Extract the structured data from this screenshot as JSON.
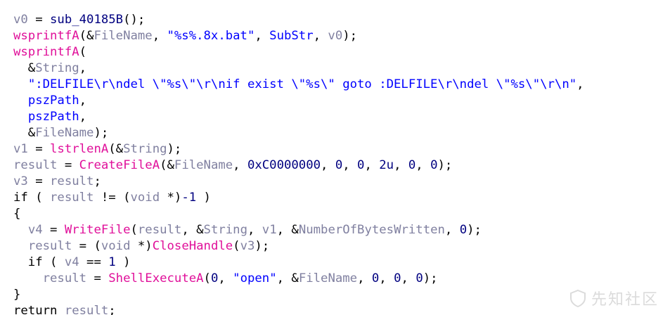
{
  "colors": {
    "plain": "#000000",
    "variable": "#8080a0",
    "function": "#e0109a",
    "string": "#0000ff",
    "number": "#000080",
    "global": "#0000ff"
  },
  "code_lines": [
    [
      {
        "t": "v0",
        "c": "variable"
      },
      {
        "t": " = ",
        "c": "plain"
      },
      {
        "t": "sub_40185B",
        "c": "number"
      },
      {
        "t": "();",
        "c": "plain"
      }
    ],
    [
      {
        "t": "wsprintfA",
        "c": "function"
      },
      {
        "t": "(&",
        "c": "plain"
      },
      {
        "t": "FileName",
        "c": "variable"
      },
      {
        "t": ", ",
        "c": "plain"
      },
      {
        "t": "\"%s%.8x.bat\"",
        "c": "string"
      },
      {
        "t": ", ",
        "c": "plain"
      },
      {
        "t": "SubStr",
        "c": "global"
      },
      {
        "t": ", ",
        "c": "plain"
      },
      {
        "t": "v0",
        "c": "variable"
      },
      {
        "t": ");",
        "c": "plain"
      }
    ],
    [
      {
        "t": "wsprintfA",
        "c": "function"
      },
      {
        "t": "(",
        "c": "plain"
      }
    ],
    [
      {
        "t": "  &",
        "c": "plain"
      },
      {
        "t": "String",
        "c": "variable"
      },
      {
        "t": ",",
        "c": "plain"
      }
    ],
    [
      {
        "t": "  ",
        "c": "plain"
      },
      {
        "t": "\":DELFILE\\r\\ndel \\\"%s\\\"\\r\\nif exist \\\"%s\\\" goto :DELFILE\\r\\ndel \\\"%s\\\"\\r\\n\"",
        "c": "string"
      },
      {
        "t": ",",
        "c": "plain"
      }
    ],
    [
      {
        "t": "  ",
        "c": "plain"
      },
      {
        "t": "pszPath",
        "c": "global"
      },
      {
        "t": ",",
        "c": "plain"
      }
    ],
    [
      {
        "t": "  ",
        "c": "plain"
      },
      {
        "t": "pszPath",
        "c": "global"
      },
      {
        "t": ",",
        "c": "plain"
      }
    ],
    [
      {
        "t": "  &",
        "c": "plain"
      },
      {
        "t": "FileName",
        "c": "variable"
      },
      {
        "t": ");",
        "c": "plain"
      }
    ],
    [
      {
        "t": "v1",
        "c": "variable"
      },
      {
        "t": " = ",
        "c": "plain"
      },
      {
        "t": "lstrlenA",
        "c": "function"
      },
      {
        "t": "(&",
        "c": "plain"
      },
      {
        "t": "String",
        "c": "variable"
      },
      {
        "t": ");",
        "c": "plain"
      }
    ],
    [
      {
        "t": "result",
        "c": "variable"
      },
      {
        "t": " = ",
        "c": "plain"
      },
      {
        "t": "CreateFileA",
        "c": "function"
      },
      {
        "t": "(&",
        "c": "plain"
      },
      {
        "t": "FileName",
        "c": "variable"
      },
      {
        "t": ", ",
        "c": "plain"
      },
      {
        "t": "0xC0000000",
        "c": "number"
      },
      {
        "t": ", ",
        "c": "plain"
      },
      {
        "t": "0",
        "c": "number"
      },
      {
        "t": ", ",
        "c": "plain"
      },
      {
        "t": "0",
        "c": "number"
      },
      {
        "t": ", ",
        "c": "plain"
      },
      {
        "t": "2u",
        "c": "number"
      },
      {
        "t": ", ",
        "c": "plain"
      },
      {
        "t": "0",
        "c": "number"
      },
      {
        "t": ", ",
        "c": "plain"
      },
      {
        "t": "0",
        "c": "number"
      },
      {
        "t": ");",
        "c": "plain"
      }
    ],
    [
      {
        "t": "v3",
        "c": "variable"
      },
      {
        "t": " = ",
        "c": "plain"
      },
      {
        "t": "result",
        "c": "variable"
      },
      {
        "t": ";",
        "c": "plain"
      }
    ],
    [
      {
        "t": "if ( ",
        "c": "plain"
      },
      {
        "t": "result",
        "c": "variable"
      },
      {
        "t": " != (",
        "c": "plain"
      },
      {
        "t": "void",
        "c": "variable"
      },
      {
        "t": " *)",
        "c": "plain"
      },
      {
        "t": "-1",
        "c": "number"
      },
      {
        "t": " )",
        "c": "plain"
      }
    ],
    [
      {
        "t": "{",
        "c": "plain"
      }
    ],
    [
      {
        "t": "  ",
        "c": "plain"
      },
      {
        "t": "v4",
        "c": "variable"
      },
      {
        "t": " = ",
        "c": "plain"
      },
      {
        "t": "WriteFile",
        "c": "function"
      },
      {
        "t": "(",
        "c": "plain"
      },
      {
        "t": "result",
        "c": "variable"
      },
      {
        "t": ", &",
        "c": "plain"
      },
      {
        "t": "String",
        "c": "variable"
      },
      {
        "t": ", ",
        "c": "plain"
      },
      {
        "t": "v1",
        "c": "variable"
      },
      {
        "t": ", &",
        "c": "plain"
      },
      {
        "t": "NumberOfBytesWritten",
        "c": "variable"
      },
      {
        "t": ", ",
        "c": "plain"
      },
      {
        "t": "0",
        "c": "number"
      },
      {
        "t": ");",
        "c": "plain"
      }
    ],
    [
      {
        "t": "  ",
        "c": "plain"
      },
      {
        "t": "result",
        "c": "variable"
      },
      {
        "t": " = (",
        "c": "plain"
      },
      {
        "t": "void",
        "c": "variable"
      },
      {
        "t": " *)",
        "c": "plain"
      },
      {
        "t": "CloseHandle",
        "c": "function"
      },
      {
        "t": "(",
        "c": "plain"
      },
      {
        "t": "v3",
        "c": "variable"
      },
      {
        "t": ");",
        "c": "plain"
      }
    ],
    [
      {
        "t": "  if ( ",
        "c": "plain"
      },
      {
        "t": "v4",
        "c": "variable"
      },
      {
        "t": " == ",
        "c": "plain"
      },
      {
        "t": "1",
        "c": "number"
      },
      {
        "t": " )",
        "c": "plain"
      }
    ],
    [
      {
        "t": "    ",
        "c": "plain"
      },
      {
        "t": "result",
        "c": "variable"
      },
      {
        "t": " = ",
        "c": "plain"
      },
      {
        "t": "ShellExecuteA",
        "c": "function"
      },
      {
        "t": "(",
        "c": "plain"
      },
      {
        "t": "0",
        "c": "number"
      },
      {
        "t": ", ",
        "c": "plain"
      },
      {
        "t": "\"open\"",
        "c": "string"
      },
      {
        "t": ", &",
        "c": "plain"
      },
      {
        "t": "FileName",
        "c": "variable"
      },
      {
        "t": ", ",
        "c": "plain"
      },
      {
        "t": "0",
        "c": "number"
      },
      {
        "t": ", ",
        "c": "plain"
      },
      {
        "t": "0",
        "c": "number"
      },
      {
        "t": ", ",
        "c": "plain"
      },
      {
        "t": "0",
        "c": "number"
      },
      {
        "t": ");",
        "c": "plain"
      }
    ],
    [
      {
        "t": "}",
        "c": "plain"
      }
    ],
    [
      {
        "t": "return ",
        "c": "plain"
      },
      {
        "t": "result",
        "c": "variable"
      },
      {
        "t": ";",
        "c": "plain"
      }
    ]
  ],
  "watermark": {
    "text": "先知社区",
    "icon": "shield-icon"
  }
}
